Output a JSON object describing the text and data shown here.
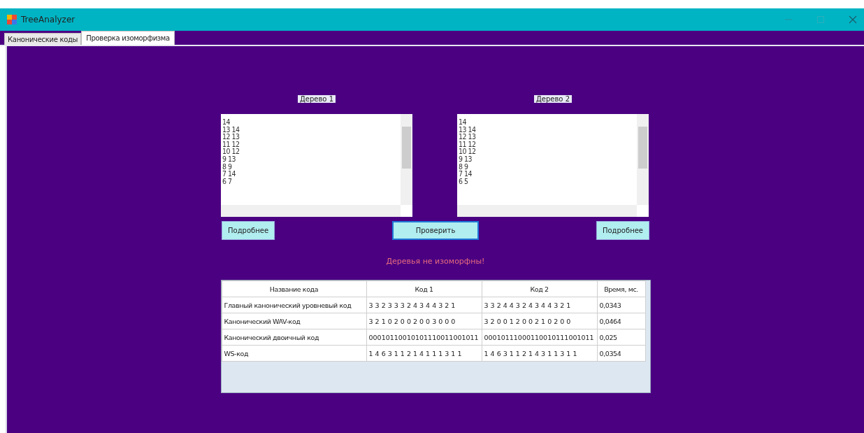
{
  "window": {
    "title": "TreeAnalyzer"
  },
  "tabs": [
    {
      "label": "Канонические коды",
      "selected": false
    },
    {
      "label": "Проверка изоморфизма",
      "selected": true
    }
  ],
  "trees": [
    {
      "label": "Дерево 1",
      "lines": [
        "14",
        "13 14",
        "12 13",
        "11 12",
        "10 12",
        "9 13",
        "8 9",
        "7 14",
        "6 7"
      ],
      "button": "Подробнее"
    },
    {
      "label": "Дерево 2",
      "lines": [
        "14",
        "13 14",
        "12 13",
        "11 12",
        "10 12",
        "9 13",
        "8 9",
        "7 14",
        "6 5"
      ],
      "button": "Подробнее"
    }
  ],
  "check_button": "Проверить",
  "result_message": "Деревья не изоморфны!",
  "table": {
    "columns": [
      "Название кода",
      "Код 1",
      "Код 2",
      "Время, мс."
    ],
    "rows": [
      [
        "Главный канонический уровневый код",
        "3 3 2 3 3 3 2 4 3 4 4 3 2 1",
        "3 3 2 4 4 3 2 4 3 4 4 3 2 1",
        "0,0343"
      ],
      [
        "Канонический WAV-код",
        "3 2 1 0 2 0 0 2 0 0 3 0 0 0",
        "3 2 0 0 1 2 0 0 2 1 0 2 0 0",
        "0,0464"
      ],
      [
        "Канонический двоичный код",
        "00010110010101110011001011",
        "00010111000110010111001011",
        "0,025"
      ],
      [
        "WS-код",
        "1 4 6 3 1 1 2 1 4 1 1 1 3 1 1",
        "1 4 6 3 1 1 2 1 4 3 1 1 3 1 1",
        "0,0354"
      ]
    ]
  }
}
